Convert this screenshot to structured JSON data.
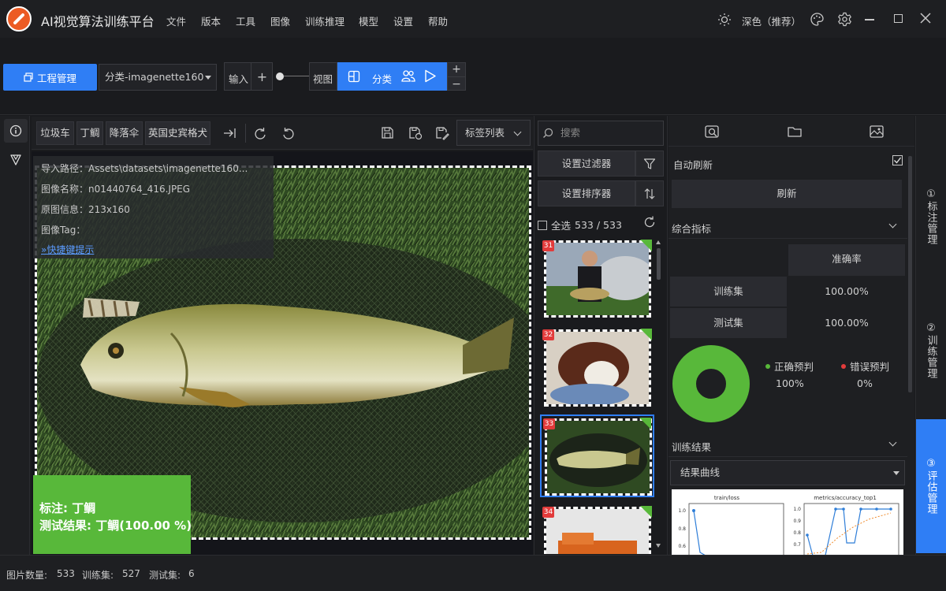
{
  "app": {
    "title": "AI视觉算法训练平台",
    "menus": [
      "文件",
      "版本",
      "工具",
      "图像",
      "训练推理",
      "模型",
      "设置",
      "帮助"
    ],
    "theme_label": "深色（推荐）"
  },
  "toolbar": {
    "project_button": "工程管理",
    "project_select": "分类-imagenette160",
    "input_label": "输入",
    "input_plus": "+",
    "view_label": "视图",
    "classify_label": "分类",
    "side_plus": "+",
    "side_minus": "−"
  },
  "image_toolbar": {
    "tags": [
      "垃圾车",
      "丁鲷",
      "降落伞",
      "英国史宾格犬"
    ],
    "tag_list_label": "标签列表"
  },
  "info_panel": {
    "import_path": "导入路径：Assets\\datasets\\imagenette160...",
    "image_name": "图像名称：n01440764_416.JPEG",
    "original_info": "原图信息：213x160",
    "image_tag": "图像Tag：",
    "shortcut_link": "»快捷键提示"
  },
  "result": {
    "label_line": "标注: 丁鲷",
    "test_line": "测试结果: 丁鲷(100.00 %)"
  },
  "thumbnails": {
    "search_placeholder": "搜索",
    "filter_button": "设置过滤器",
    "sorter_button": "设置排序器",
    "select_all": "全选",
    "selection_count": "533 / 533",
    "items": [
      {
        "badge": "31",
        "kind": "person"
      },
      {
        "badge": "32",
        "kind": "dog"
      },
      {
        "badge": "33",
        "kind": "fish",
        "selected": true
      },
      {
        "badge": "34",
        "kind": "truck"
      }
    ]
  },
  "right_panel": {
    "auto_refresh": "自动刷新",
    "refresh_button": "刷新",
    "metrics_section": "综合指标",
    "metrics_table": {
      "header": "准确率",
      "rows": [
        {
          "label": "训练集",
          "value": "100.00%"
        },
        {
          "label": "测试集",
          "value": "100.00%"
        }
      ]
    },
    "pie": {
      "correct_label": "正确预判",
      "correct_value": "100%",
      "wrong_label": "错误预判",
      "wrong_value": "0%",
      "correct_color": "#58b83a",
      "wrong_color": "#e23b3b"
    },
    "results_section": "训练结果",
    "results_select": "结果曲线",
    "plot_titles": [
      "train/loss",
      "metrics/accuracy_top1"
    ]
  },
  "side_tabs": [
    {
      "label": "①标注管理"
    },
    {
      "label": "②训练管理"
    },
    {
      "label": "③评估管理",
      "active": true
    }
  ],
  "status": {
    "image_count_label": "图片数量:",
    "image_count": "533",
    "train_label": "训练集:",
    "train_count": "527",
    "test_label": "测试集:",
    "test_count": "6"
  },
  "colors": {
    "accent": "#2f7ef5",
    "success": "#58b83a",
    "error": "#e23b3b"
  }
}
